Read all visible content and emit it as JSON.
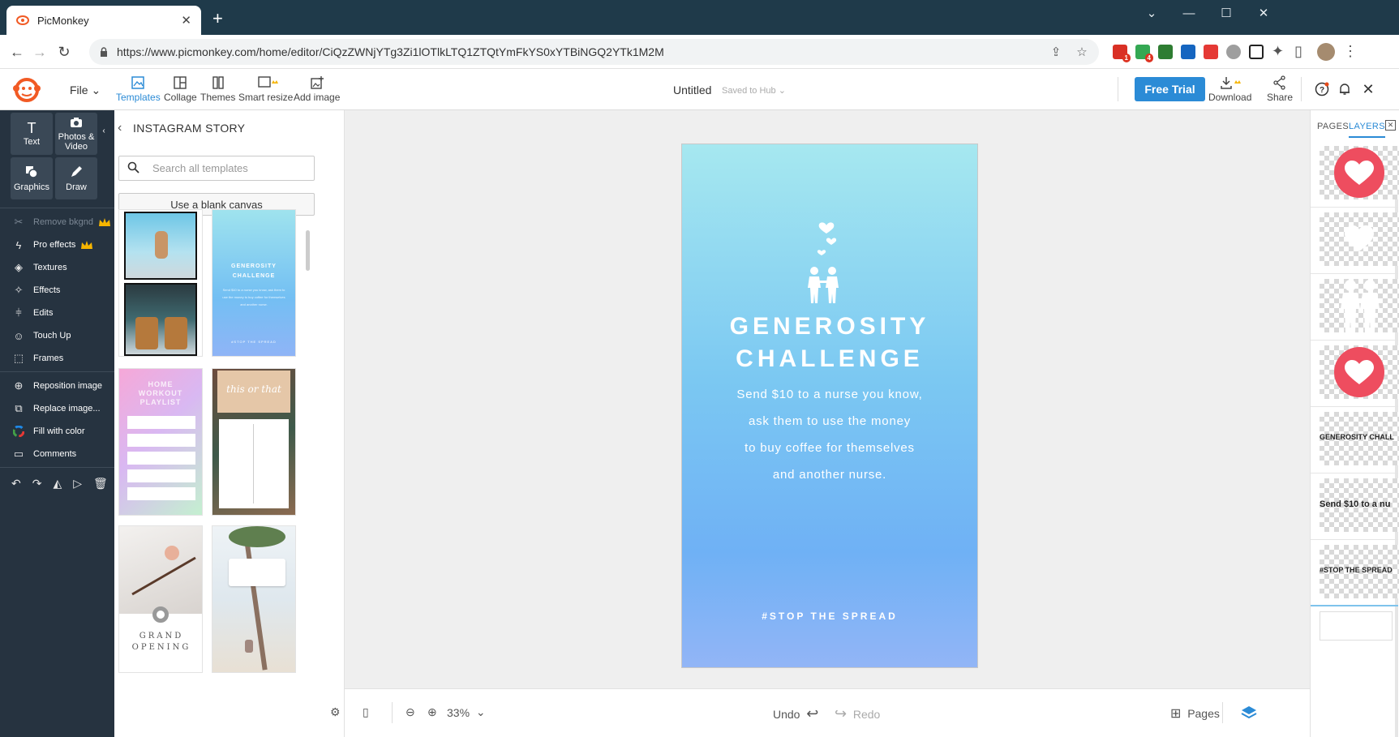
{
  "browser": {
    "tab_title": "PicMonkey",
    "url": "https://www.picmonkey.com/home/editor/CiQzZWNjYTg3Zi1lOTlkLTQ1ZTQtYmFkYS0xYTBiNGQ2YTk1M2M",
    "extension_badges": [
      "1",
      "4"
    ]
  },
  "header": {
    "file_label": "File",
    "tools": [
      {
        "label": "Templates",
        "icon": "templates-icon"
      },
      {
        "label": "Collage",
        "icon": "collage-icon"
      },
      {
        "label": "Themes",
        "icon": "themes-icon"
      },
      {
        "label": "Smart resize",
        "icon": "smart-resize-icon"
      },
      {
        "label": "Add image",
        "icon": "add-image-icon"
      }
    ],
    "doc_title": "Untitled",
    "saved_status": "Saved to Hub",
    "free_trial": "Free Trial",
    "download": "Download",
    "share": "Share"
  },
  "sidebar": {
    "big_buttons": [
      {
        "label": "Text",
        "icon": "text-tool-icon"
      },
      {
        "label": "Photos & Video",
        "icon": "camera-icon"
      },
      {
        "label": "Graphics",
        "icon": "graphics-icon"
      },
      {
        "label": "Draw",
        "icon": "draw-icon"
      }
    ],
    "items": [
      {
        "label": "Remove bkgnd",
        "icon": "scissors-icon"
      },
      {
        "label": "Pro effects",
        "icon": "pro-effects-icon"
      },
      {
        "label": "Textures",
        "icon": "textures-icon"
      },
      {
        "label": "Effects",
        "icon": "effects-icon"
      },
      {
        "label": "Edits",
        "icon": "edits-icon"
      },
      {
        "label": "Touch Up",
        "icon": "touch-up-icon"
      },
      {
        "label": "Frames",
        "icon": "frames-icon"
      },
      {
        "label": "Reposition image",
        "icon": "reposition-icon"
      },
      {
        "label": "Replace image...",
        "icon": "replace-image-icon"
      },
      {
        "label": "Fill with color",
        "icon": "color-wheel-icon"
      },
      {
        "label": "Comments",
        "icon": "comments-icon"
      }
    ]
  },
  "templates_panel": {
    "title": "INSTAGRAM STORY",
    "search_placeholder": "Search all templates",
    "blank_canvas": "Use a blank canvas",
    "thumbs": {
      "generosity_title_1": "GENEROSITY",
      "generosity_title_2": "CHALLENGE",
      "generosity_body": "Send $10 to a nurse you know, ask them to use the money to buy coffee for themselves and another nurse.",
      "generosity_tag": "#STOP THE SPREAD",
      "workout_1": "HOME",
      "workout_2": "WORKOUT",
      "workout_3": "PLAYLIST",
      "this_or_that": "this or that",
      "grand_1": "GRAND",
      "grand_2": "OPENING"
    }
  },
  "canvas": {
    "headline_1": "GENEROSITY",
    "headline_2": "CHALLENGE",
    "body_lines": [
      "Send $10 to a nurse you know,",
      "ask them to use the money",
      "to buy coffee for themselves",
      "and another nurse."
    ],
    "tag": "#STOP THE SPREAD",
    "colors": {
      "gradient_top": "#a6e8f0",
      "gradient_mid": "#7bc8f2",
      "gradient_bottom": "#92b5f6"
    }
  },
  "bottombar": {
    "zoom": "33%",
    "undo": "Undo",
    "redo": "Redo",
    "pages": "Pages"
  },
  "layers_panel": {
    "tab_pages": "PAGES",
    "tab_layers": "LAYERS",
    "layers": [
      {
        "type": "heart-red"
      },
      {
        "type": "heart-white"
      },
      {
        "type": "people-white"
      },
      {
        "type": "heart-red"
      },
      {
        "type": "text",
        "text": "GENEROSITY CHALL"
      },
      {
        "type": "text",
        "text": "Send $10 to a nu"
      },
      {
        "type": "text",
        "text": "#STOP THE SPREAD"
      }
    ]
  }
}
